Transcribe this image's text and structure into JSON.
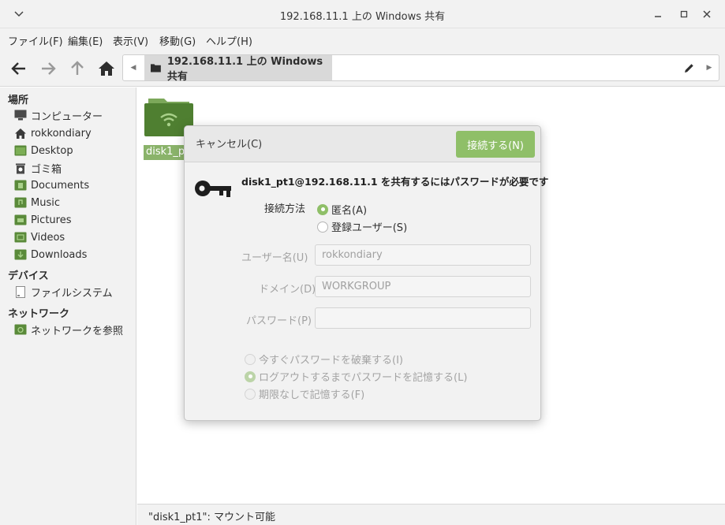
{
  "window": {
    "title": "192.168.11.1 上の Windows 共有"
  },
  "menubar": {
    "items": [
      "ファイル(F)",
      "編集(E)",
      "表示(V)",
      "移動(G)",
      "ヘルプ(H)"
    ]
  },
  "pathbar": {
    "crumb": "192.168.11.1 上の Windows 共有"
  },
  "sidebar": {
    "places_heading": "場所",
    "places": [
      {
        "label": "コンピューター",
        "icon": "computer-icon"
      },
      {
        "label": "rokkondiary",
        "icon": "home-icon"
      },
      {
        "label": "Desktop",
        "icon": "desktop-folder-icon"
      },
      {
        "label": "ゴミ箱",
        "icon": "trash-icon"
      },
      {
        "label": "Documents",
        "icon": "documents-folder-icon"
      },
      {
        "label": "Music",
        "icon": "music-folder-icon"
      },
      {
        "label": "Pictures",
        "icon": "pictures-folder-icon"
      },
      {
        "label": "Videos",
        "icon": "videos-folder-icon"
      },
      {
        "label": "Downloads",
        "icon": "downloads-folder-icon"
      }
    ],
    "devices_heading": "デバイス",
    "devices": [
      {
        "label": "ファイルシステム",
        "icon": "drive-icon"
      }
    ],
    "network_heading": "ネットワーク",
    "network": [
      {
        "label": "ネットワークを参照",
        "icon": "network-folder-icon"
      }
    ]
  },
  "content": {
    "folder_label": "disk1_pt1"
  },
  "statusbar": {
    "text": "\"disk1_pt1\": マウント可能"
  },
  "dialog": {
    "cancel_label": "キャンセル(C)",
    "connect_label": "接続する(N)",
    "message": "disk1_pt1@192.168.11.1 を共有するにはパスワードが必要です",
    "method_label": "接続方法",
    "method_options": [
      {
        "label": "匿名(A)",
        "selected": true
      },
      {
        "label": "登録ユーザー(S)",
        "selected": false
      }
    ],
    "username_label": "ユーザー名(U)",
    "username_value": "rokkondiary",
    "domain_label": "ドメイン(D)",
    "domain_value": "WORKGROUP",
    "password_label": "パスワード(P)",
    "password_value": "",
    "remember_options": [
      {
        "label": "今すぐパスワードを破棄する(I)",
        "selected": false
      },
      {
        "label": "ログアウトするまでパスワードを記憶する(L)",
        "selected": true
      },
      {
        "label": "期限なしで記憶する(F)",
        "selected": false
      }
    ]
  },
  "colors": {
    "accent": "#8fbf68",
    "folder": "#5a8a3a",
    "selection": "#8ab36a"
  }
}
